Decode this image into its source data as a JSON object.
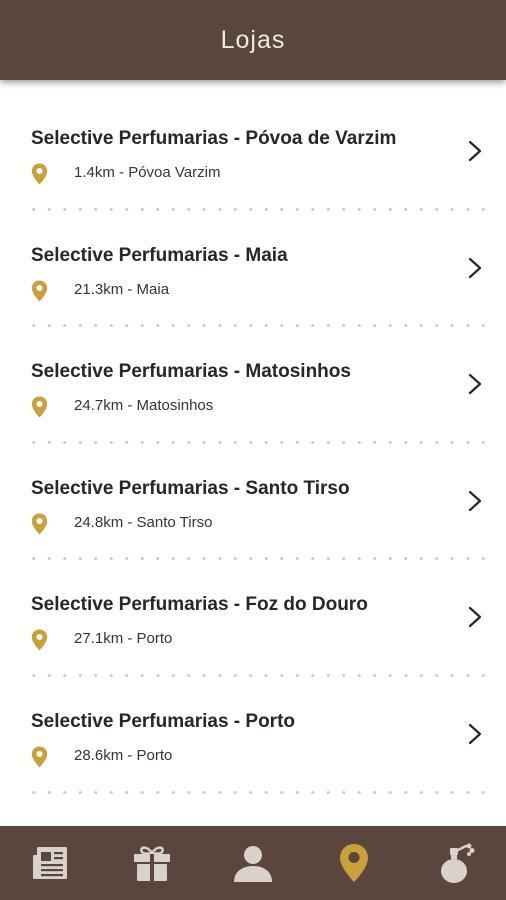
{
  "header": {
    "title": "Lojas"
  },
  "stores": [
    {
      "name": "Selective Perfumarias - Póvoa de Varzim",
      "distance": "1.4km",
      "city": "Póvoa Varzim"
    },
    {
      "name": "Selective Perfumarias - Maia",
      "distance": "21.3km",
      "city": "Maia"
    },
    {
      "name": "Selective Perfumarias - Matosinhos",
      "distance": "24.7km",
      "city": "Matosinhos"
    },
    {
      "name": "Selective Perfumarias - Santo Tirso",
      "distance": "24.8km",
      "city": "Santo Tirso"
    },
    {
      "name": "Selective Perfumarias - Foz do Douro",
      "distance": "27.1km",
      "city": "Porto"
    },
    {
      "name": "Selective Perfumarias - Porto",
      "distance": "28.6km",
      "city": "Porto"
    }
  ],
  "tabbar": {
    "tabs": [
      {
        "icon": "newspaper-icon",
        "active": false
      },
      {
        "icon": "gift-icon",
        "active": false
      },
      {
        "icon": "user-icon",
        "active": false
      },
      {
        "icon": "location-pin-icon",
        "active": true
      },
      {
        "icon": "perfume-bottle-icon",
        "active": false
      }
    ]
  },
  "colors": {
    "header_bg": "#5a463f",
    "accent_gold": "#c9a03a",
    "tab_icon_inactive": "#d9d2cc",
    "text_dark": "#2c2521"
  }
}
